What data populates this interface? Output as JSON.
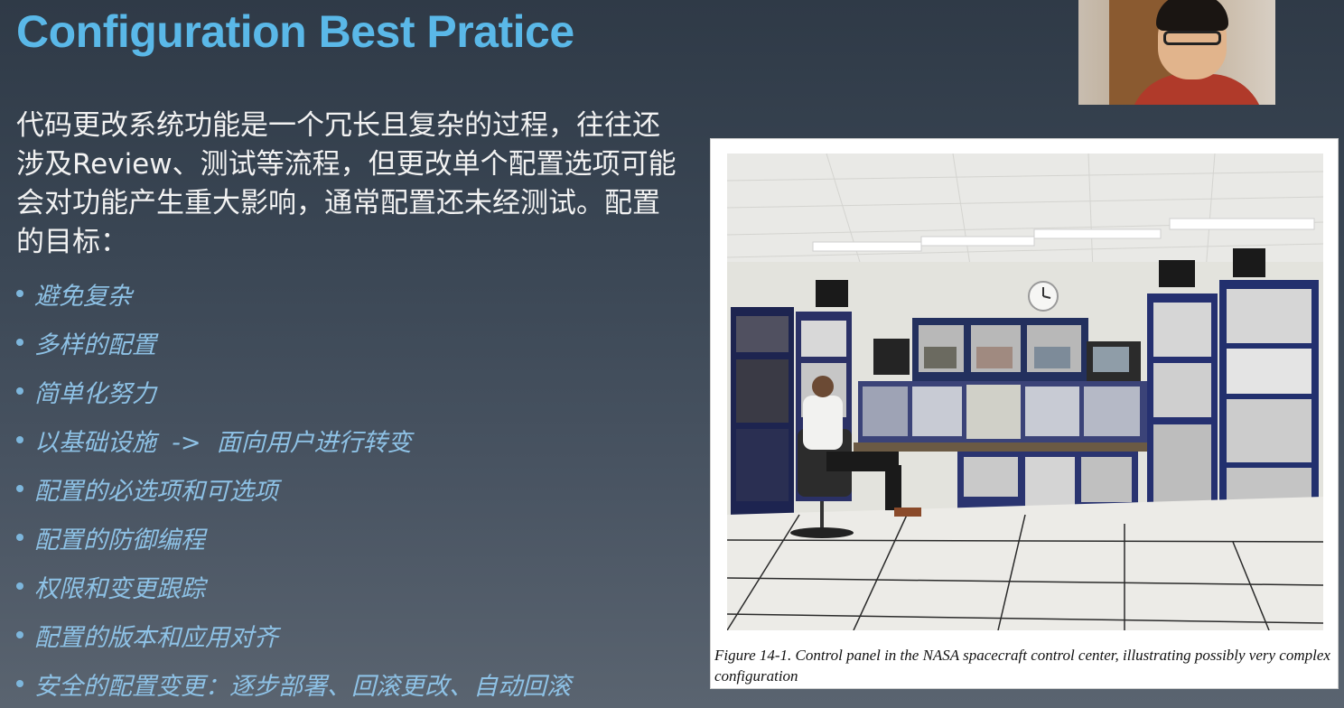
{
  "slide": {
    "title": "Configuration Best Pratice",
    "intro": "代码更改系统功能是一个冗长且复杂的过程，往往还涉及Review、测试等流程，但更改单个配置选项可能会对功能产生重大影响，通常配置还未经测试。配置的目标：",
    "bullets": [
      "避免复杂",
      "多样的配置",
      "简单化努力",
      "以基础设施  ->  面向用户进行转变",
      "配置的必选项和可选项",
      "配置的防御编程",
      "权限和变更跟踪",
      "配置的版本和应用对齐",
      "安全的配置变更：逐步部署、回滚更改、自动回滚"
    ],
    "figure_caption": "Figure 14-1. Control panel in the NASA spacecraft control center, illustrating possibly very complex configuration"
  },
  "colors": {
    "title": "#5ab8e8",
    "bullet_text": "#8ec2e6",
    "body_text": "#f2f2f2"
  }
}
